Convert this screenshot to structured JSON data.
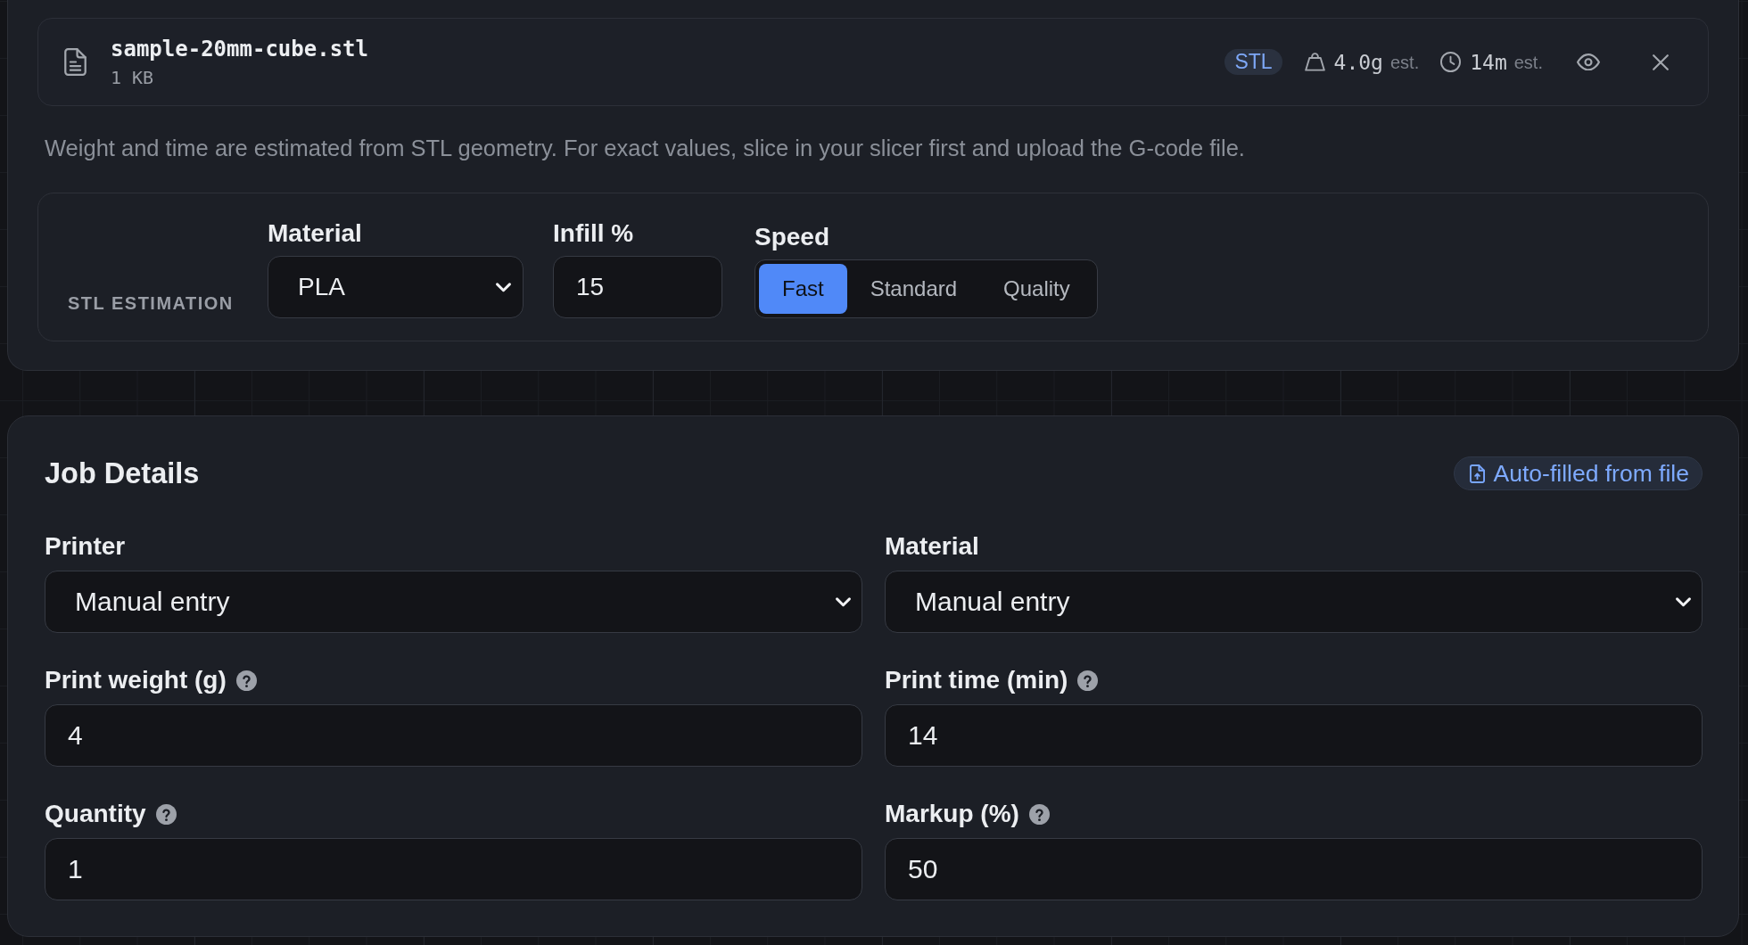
{
  "file": {
    "name": "sample-20mm-cube.stl",
    "size": "1 KB",
    "type": "STL",
    "weight": "4.0g",
    "weight_note": "est.",
    "time": "14m",
    "time_note": "est."
  },
  "note": "Weight and time are estimated from STL geometry. For exact values, slice in your slicer first and upload the G-code file.",
  "stl_estimation": {
    "title": "STL ESTIMATION",
    "fields": [
      {
        "kind": "select",
        "label": "Material",
        "value": "PLA"
      },
      {
        "kind": "number",
        "label": "Infill %",
        "value": "15"
      }
    ],
    "speed": {
      "label": "Speed",
      "options": [
        {
          "label": "Fast",
          "selected": true
        },
        {
          "label": "Standard",
          "selected": false
        },
        {
          "label": "Quality",
          "selected": false
        }
      ]
    }
  },
  "job_details": {
    "title": "Job Details",
    "badge": "Auto-filled from file",
    "fields": [
      {
        "kind": "select",
        "label": "Printer",
        "value": "Manual entry",
        "help": false
      },
      {
        "kind": "select",
        "label": "Material",
        "value": "Manual entry",
        "help": false
      },
      {
        "kind": "number",
        "label": "Print weight (g)",
        "value": "4",
        "help": true
      },
      {
        "kind": "number",
        "label": "Print time (min)",
        "value": "14",
        "help": true
      },
      {
        "kind": "number",
        "label": "Quantity",
        "value": "1",
        "help": true
      },
      {
        "kind": "number",
        "label": "Markup (%)",
        "value": "50",
        "help": true
      }
    ]
  }
}
